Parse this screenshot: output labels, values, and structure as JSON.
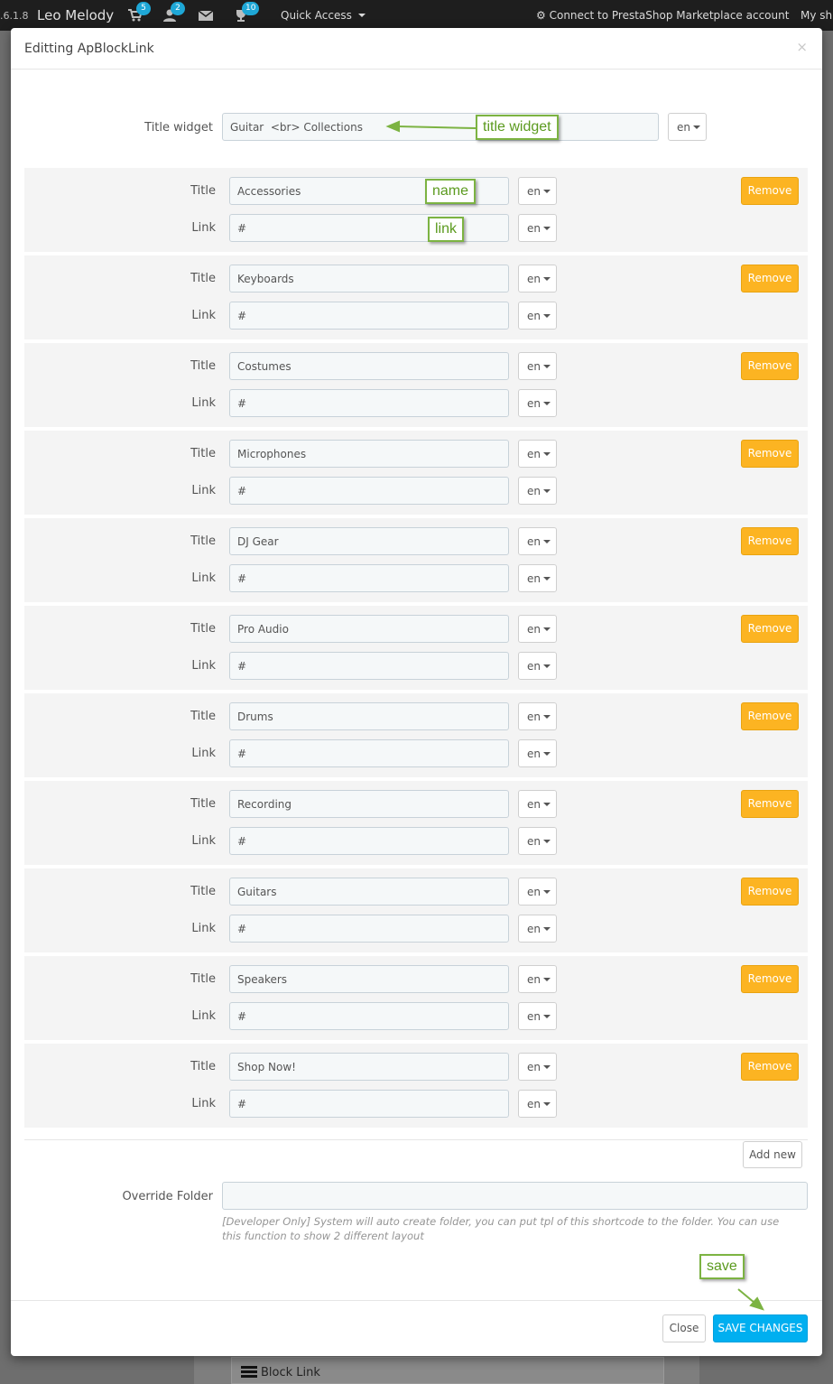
{
  "topbar": {
    "version": ".6.1.8",
    "shop_name": "Leo Melody",
    "orders_count": "5",
    "customers_count": "2",
    "trophy_count": "10",
    "quick_access": "Quick Access",
    "marketplace": "Connect to PrestaShop Marketplace account",
    "my_shop": "My sh"
  },
  "modal": {
    "title": "Editting ApBlockLink",
    "close_glyph": "×",
    "title_widget_label": "Title widget",
    "title_widget_value": "Guitar  <br> Collections",
    "lang": "en",
    "title_label": "Title",
    "link_label": "Link",
    "remove_label": "Remove",
    "links": [
      {
        "title": "Accessories",
        "link": "#"
      },
      {
        "title": "Keyboards",
        "link": "#"
      },
      {
        "title": "Costumes",
        "link": "#"
      },
      {
        "title": "Microphones",
        "link": "#"
      },
      {
        "title": "DJ Gear",
        "link": "#"
      },
      {
        "title": "Pro Audio",
        "link": "#"
      },
      {
        "title": "Drums",
        "link": "#"
      },
      {
        "title": "Recording",
        "link": "#"
      },
      {
        "title": "Guitars",
        "link": "#"
      },
      {
        "title": "Speakers",
        "link": "#"
      },
      {
        "title": "Shop Now!",
        "link": "#"
      }
    ],
    "add_new_label": "Add new",
    "override_folder_label": "Override Folder",
    "override_folder_value": "",
    "help_text": "[Developer Only] System will auto create folder, you can put tpl of this shortcode to the folder. You can use this function to show 2 different layout",
    "close_button": "Close",
    "save_button": "SAVE CHANGES"
  },
  "annotations": {
    "title_widget": "title widget",
    "name": "name",
    "link": "link",
    "save": "save"
  },
  "background": {
    "block_link_label": "Block Link"
  },
  "colors": {
    "remove_button": "#fcb422",
    "save_button": "#00aff0",
    "annotation": "#7cb342",
    "badge": "#1ea7d6"
  }
}
